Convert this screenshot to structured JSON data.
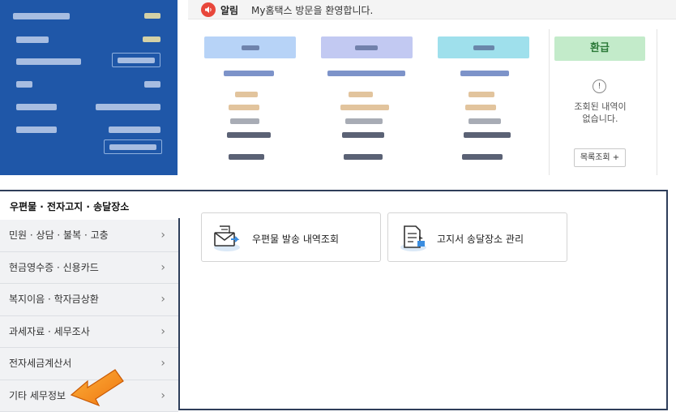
{
  "notice": {
    "title": "알림",
    "message": "My홈택스 방문을 환영합니다."
  },
  "refund": {
    "header": "환급",
    "info_symbol": "!",
    "empty_line1": "조회된 내역이",
    "empty_line2": "없습니다.",
    "list_button": "목록조회 +"
  },
  "section": {
    "title": "우편물 · 전자고지 · 송달장소"
  },
  "sidebar": {
    "items": [
      {
        "label": "민원 · 상담 · 불복 · 고충",
        "chevron": "›"
      },
      {
        "label": "현금영수증 · 신용카드",
        "chevron": "›"
      },
      {
        "label": "복지이음 · 학자금상환",
        "chevron": "›"
      },
      {
        "label": "과세자료 · 세무조사",
        "chevron": "›"
      },
      {
        "label": "전자세금계산서",
        "chevron": "›"
      },
      {
        "label": "기타 세무정보",
        "chevron": "›"
      }
    ]
  },
  "cards": [
    {
      "label": "우편물 발송 내역조회",
      "icon": "mail-send-icon"
    },
    {
      "label": "고지서 송달장소 관리",
      "icon": "document-location-icon"
    }
  ],
  "colors": {
    "panel_blue": "#1f57a8",
    "refund_green": "#c3ebca",
    "arrow_orange": "#f08a1c",
    "section_border": "#2e3e5a"
  }
}
